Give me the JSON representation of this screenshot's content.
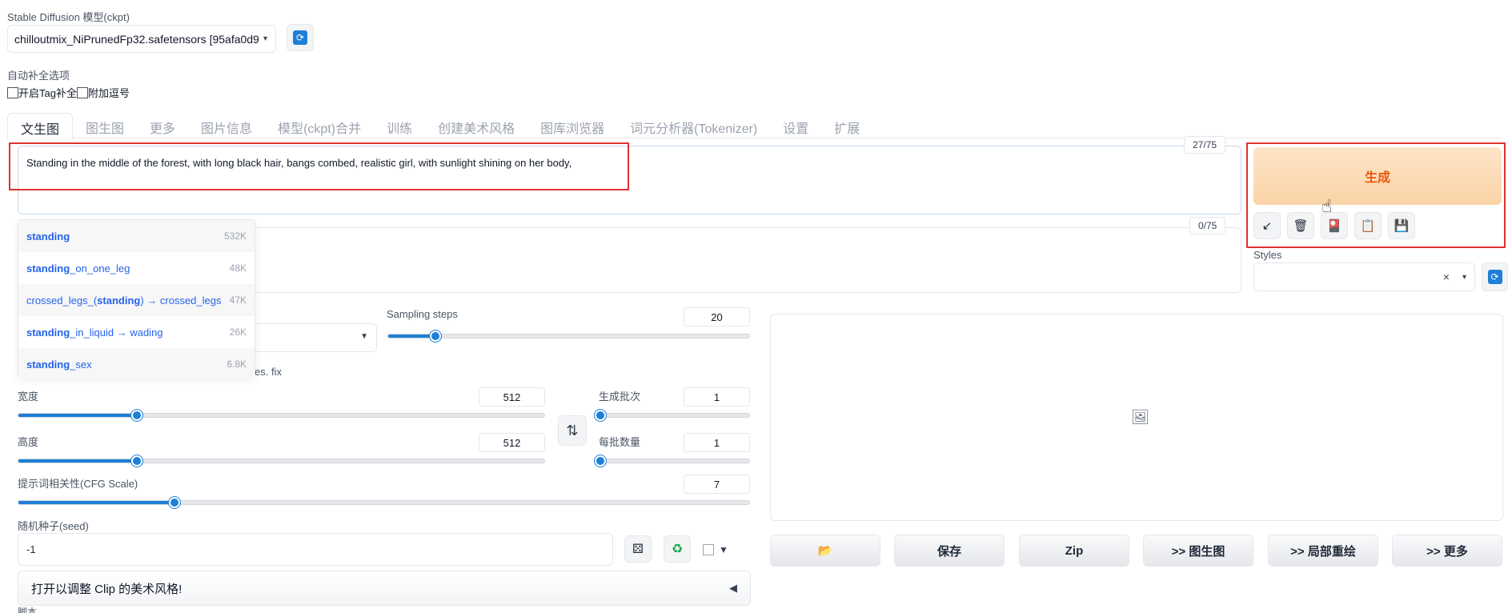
{
  "model": {
    "label": "Stable Diffusion 模型(ckpt)",
    "selected": "chilloutmix_NiPrunedFp32.safetensors [95afa0d9"
  },
  "autocomplete_options": {
    "label": "自动补全选项",
    "checkbox_tag": "开启Tag补全",
    "checkbox_comma": "附加逗号"
  },
  "tabs": [
    {
      "label": "文生图",
      "active": true
    },
    {
      "label": "图生图"
    },
    {
      "label": "更多"
    },
    {
      "label": "图片信息"
    },
    {
      "label": "模型(ckpt)合并"
    },
    {
      "label": "训练"
    },
    {
      "label": "创建美术风格"
    },
    {
      "label": "图库浏览器"
    },
    {
      "label": "词元分析器(Tokenizer)"
    },
    {
      "label": "设置"
    },
    {
      "label": "扩展"
    }
  ],
  "prompt": {
    "text": "Standing in the middle of the forest, with long black hair, bangs combed, realistic girl, with sunlight shining on her body,",
    "counter": "27/75"
  },
  "negative_prompt": {
    "counter": "0/75"
  },
  "suggestions": [
    {
      "pre": "",
      "match": "standing",
      "post": "",
      "count": "532K"
    },
    {
      "pre": "",
      "match": "standing",
      "post": "_on_one_leg",
      "count": "48K"
    },
    {
      "pre": "crossed_legs_(",
      "match": "standing",
      "post": ") → crossed_legs",
      "count": "47K"
    },
    {
      "pre": "",
      "match": "standing",
      "post": "_in_liquid → wading",
      "count": "26K"
    },
    {
      "pre": "",
      "match": "standing",
      "post": "_sex",
      "count": "6.8K"
    }
  ],
  "generate": {
    "label": "生成"
  },
  "tools": {
    "arrow": "↙",
    "trash": "🗑",
    "image": "🎴",
    "clipboard": "📋",
    "save": "💾"
  },
  "styles": {
    "label": "Styles",
    "clear": "×"
  },
  "params": {
    "sampling_steps_label": "Sampling steps",
    "sampling_steps": "20",
    "sampling_steps_fraction": 0.133,
    "hires_fix_tail": "es. fix",
    "width_label": "宽度",
    "width": "512",
    "width_fraction": 0.226,
    "height_label": "高度",
    "height": "512",
    "height_fraction": 0.226,
    "batch_count_label": "生成批次",
    "batch_count": "1",
    "batch_count_fraction": 0.0,
    "batch_size_label": "每批数量",
    "batch_size": "1",
    "batch_size_fraction": 0.0,
    "cfg_label": "提示词相关性(CFG Scale)",
    "cfg": "7",
    "cfg_fraction": 0.214,
    "seed_label": "随机种子(seed)",
    "seed": "-1"
  },
  "swap_icon": "⇅",
  "output_buttons": {
    "folder": "📂",
    "save": "保存",
    "zip": "Zip",
    "to_img2img": ">> 图生图",
    "to_inpaint": ">> 局部重绘",
    "to_extras": ">> 更多"
  },
  "accordion": {
    "label": "打开以调整 Clip 的美术风格!",
    "arrow": "◀"
  },
  "script_label": "脚本",
  "colors": {
    "accent": "#1d7fd6",
    "generate_text": "#ea580c",
    "highlight": "#e03131"
  }
}
